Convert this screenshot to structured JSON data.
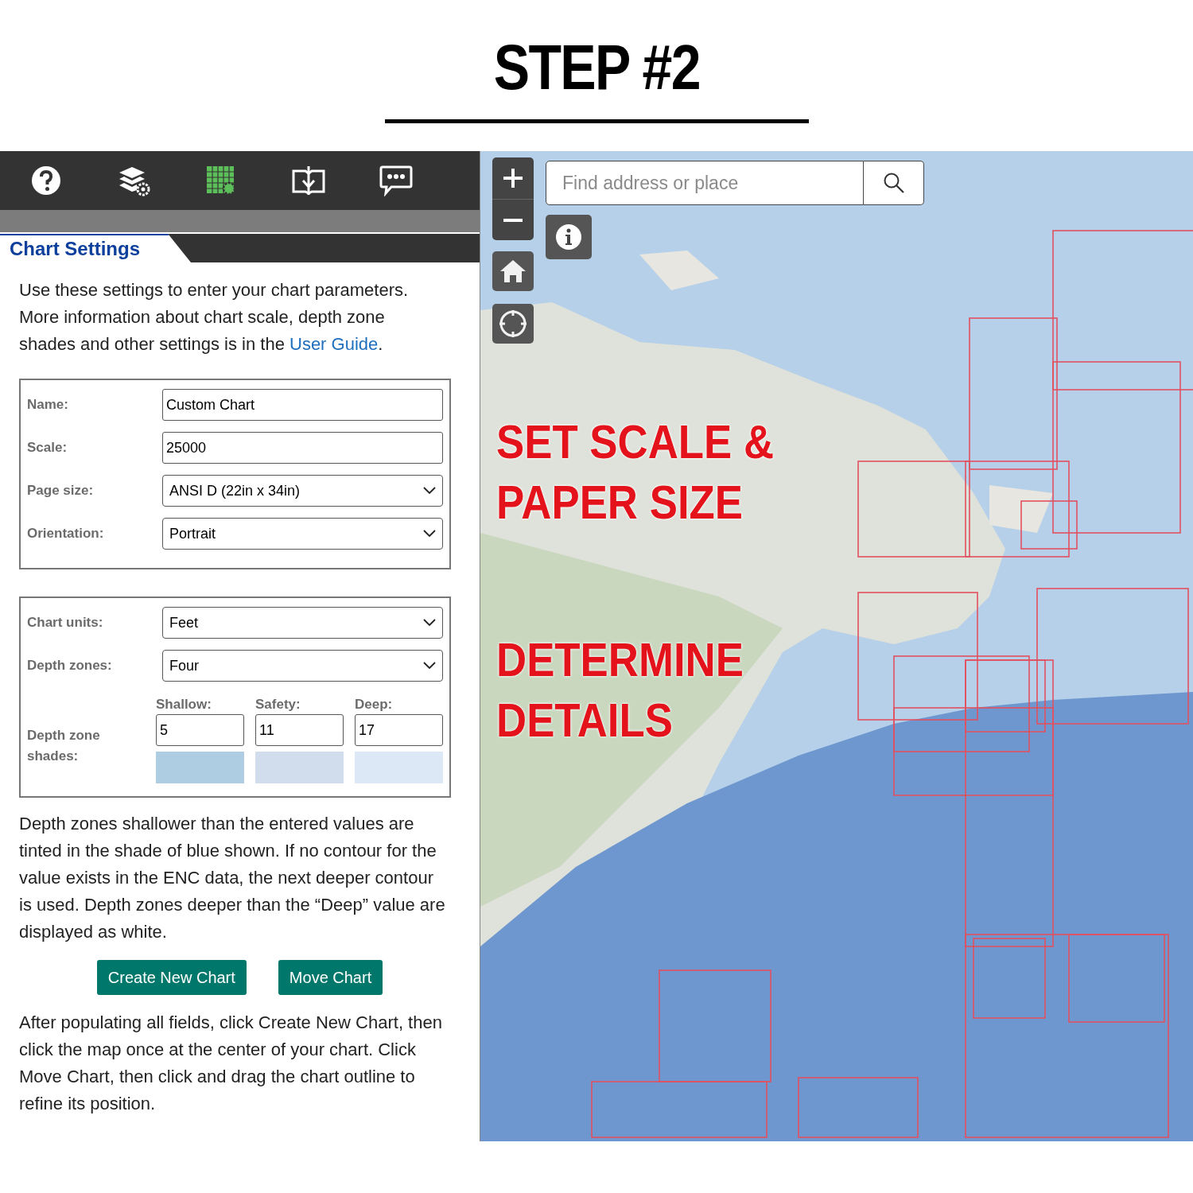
{
  "heading": "STEP #2",
  "toolbar": [
    {
      "kind": "help",
      "selected": false
    },
    {
      "kind": "layers",
      "selected": false
    },
    {
      "kind": "chart",
      "selected": true
    },
    {
      "kind": "book",
      "selected": false
    },
    {
      "kind": "chat",
      "selected": false
    }
  ],
  "panel": {
    "tab": "Chart Settings",
    "intro": "Use these settings to enter your chart parameters. More information about chart scale, depth zone shades and other settings is in the ",
    "intro_link": "User Guide",
    "intro_end": ".",
    "fields": [
      {
        "label": "Name:",
        "kind": "text",
        "value": "Custom Chart"
      },
      {
        "label": "Scale:",
        "kind": "text",
        "value": "25000"
      },
      {
        "label": "Page size:",
        "kind": "select",
        "value": "ANSI D (22in x 34in)"
      },
      {
        "label": "Orientation:",
        "kind": "select",
        "value": "Portrait"
      }
    ],
    "depth_fields": [
      {
        "label": "Chart units:",
        "kind": "select",
        "value": "Feet"
      },
      {
        "label": "Depth zones:",
        "kind": "select",
        "value": "Four"
      }
    ],
    "shades_label": "Depth zone shades:",
    "zones": [
      {
        "label": "Shallow:",
        "value": "5",
        "color": "#aecde3"
      },
      {
        "label": "Safety:",
        "value": "11",
        "color": "#d1dded"
      },
      {
        "label": "Deep:",
        "value": "17",
        "color": "#dce8f5"
      }
    ],
    "note": "Depth zones shallower than the entered values are tinted in the shade of blue shown. If no contour for the value exists in the ENC data, the next deeper contour is used. Depth zones deeper than the “Deep” value are displayed as white.",
    "buttons": [
      "Create New Chart",
      "Move Chart"
    ],
    "footer": "After populating all fields, click Create New Chart, then click the map once at the center of your chart. Click Move Chart, then click and drag the chart outline to refine its position."
  },
  "map": {
    "search": {
      "placeholder": "Find address or place"
    },
    "annotations": [
      [
        "SET SCALE &",
        "PAPER SIZE"
      ],
      [
        "DETERMINE",
        "DETAILS"
      ]
    ]
  }
}
